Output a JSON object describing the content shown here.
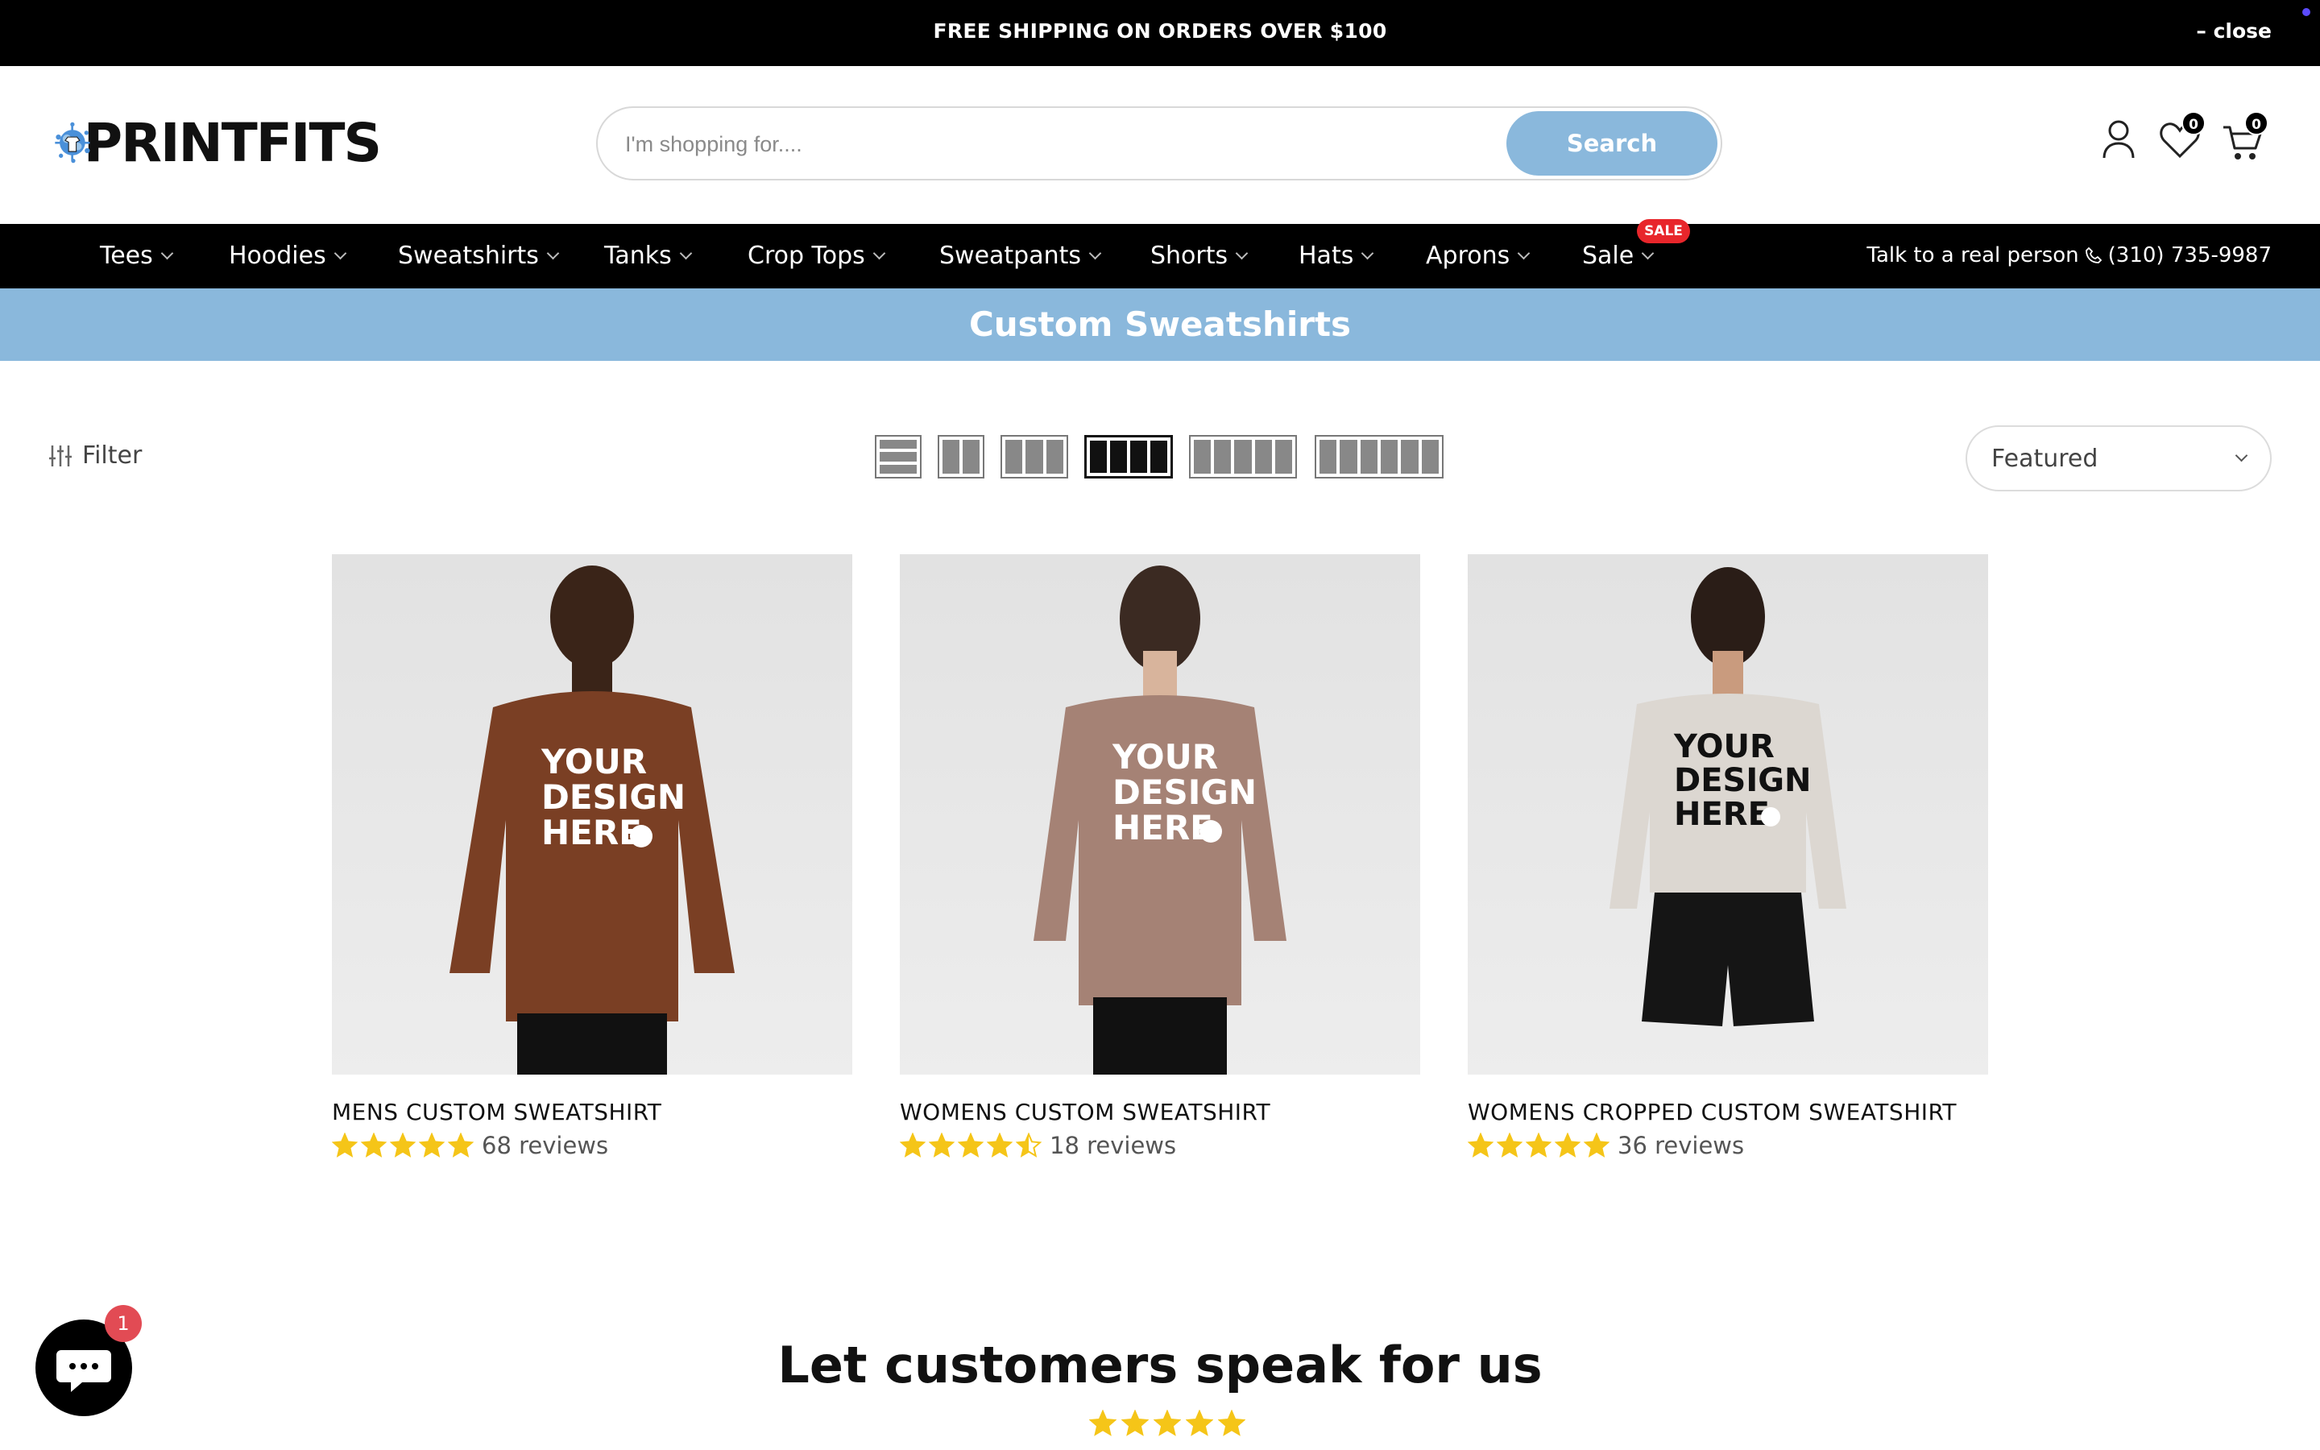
{
  "announcement": {
    "text": "FREE SHIPPING ON ORDERS OVER $100",
    "close_label": "– close"
  },
  "brand": {
    "name": "PRINTFITS",
    "accent_color": "#8ab8dc"
  },
  "search": {
    "placeholder": "I'm shopping for....",
    "button_label": "Search"
  },
  "header_icons": {
    "account_icon": "user-icon",
    "wishlist_icon": "heart-icon",
    "wishlist_count": "0",
    "cart_icon": "cart-icon",
    "cart_count": "0"
  },
  "nav": {
    "items": [
      {
        "label": "Tees"
      },
      {
        "label": "Hoodies"
      },
      {
        "label": "Sweatshirts"
      },
      {
        "label": "Tanks"
      },
      {
        "label": "Crop Tops"
      },
      {
        "label": "Sweatpants"
      },
      {
        "label": "Shorts"
      },
      {
        "label": "Hats"
      },
      {
        "label": "Aprons"
      },
      {
        "label": "Sale"
      }
    ],
    "sale_badge": "SALE",
    "contact_text": "Talk to a real person",
    "phone": "(310) 735-9987"
  },
  "collection": {
    "title": "Custom Sweatshirts"
  },
  "toolbar": {
    "filter_label": "Filter",
    "sort_value": "Featured",
    "active_view": "4-columns"
  },
  "products": [
    {
      "title": "MENS CUSTOM SWEATSHIRT",
      "rating": 5,
      "reviews": "68 reviews",
      "shirt_color": "#7a3f24",
      "print_text": [
        "YOUR",
        "DESIGN",
        "HERE"
      ]
    },
    {
      "title": "WOMENS CUSTOM SWEATSHIRT",
      "rating": 4.5,
      "reviews": "18 reviews",
      "shirt_color": "#a58275",
      "print_text": [
        "YOUR",
        "DESIGN",
        "HERE"
      ]
    },
    {
      "title": "WOMENS CROPPED CUSTOM SWEATSHIRT",
      "rating": 5,
      "reviews": "36 reviews",
      "shirt_color": "#dcd7d1",
      "print_text": [
        "YOUR",
        "DESIGN",
        "HERE"
      ]
    }
  ],
  "testimonials": {
    "heading": "Let customers speak for us",
    "rating": 5
  },
  "chat": {
    "icon": "chat-icon",
    "unread": "1"
  }
}
